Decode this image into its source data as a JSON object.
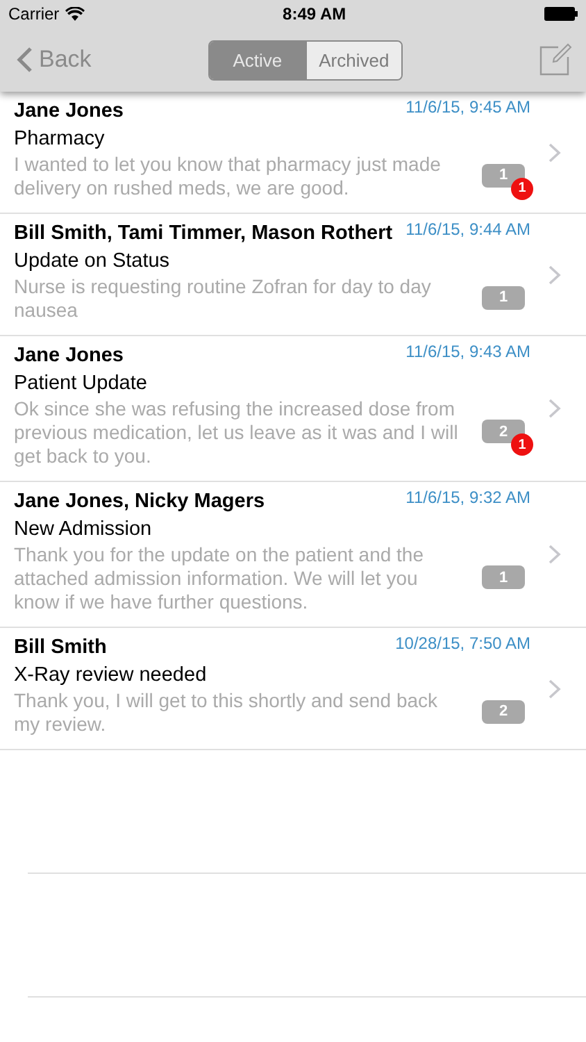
{
  "status_bar": {
    "carrier": "Carrier",
    "time": "8:49 AM"
  },
  "nav": {
    "back": "Back",
    "segments": [
      {
        "label": "Active",
        "selected": true
      },
      {
        "label": "Archived",
        "selected": false
      }
    ]
  },
  "messages": [
    {
      "sender": "Jane Jones",
      "date": "11/6/15, 9:45 AM",
      "subject": "Pharmacy",
      "preview": "I wanted to let you know that pharmacy just made delivery on rushed meds, we are good.",
      "count": "1",
      "unread": "1"
    },
    {
      "sender": "Bill Smith, Tami Timmer, Mason Rothert",
      "date": "11/6/15, 9:44 AM",
      "subject": "Update on Status",
      "preview": "Nurse is requesting routine Zofran for day to day nausea",
      "count": "1"
    },
    {
      "sender": "Jane Jones",
      "date": "11/6/15, 9:43 AM",
      "subject": "Patient Update",
      "preview": "Ok since she was refusing the increased dose from previous medication, let us leave as it was and I will get back to you.",
      "count": "2",
      "unread": "1"
    },
    {
      "sender": "Jane Jones, Nicky Magers",
      "date": "11/6/15, 9:32 AM",
      "subject": "New Admission",
      "preview": "Thank you for the update on the patient and the attached admission information.  We will let you know if we have further questions.",
      "count": "1"
    },
    {
      "sender": "Bill Smith",
      "date": "10/28/15, 7:50 AM",
      "subject": "X-Ray review needed",
      "preview": "Thank you, I will get to this shortly and send back my review.",
      "count": "2"
    }
  ]
}
